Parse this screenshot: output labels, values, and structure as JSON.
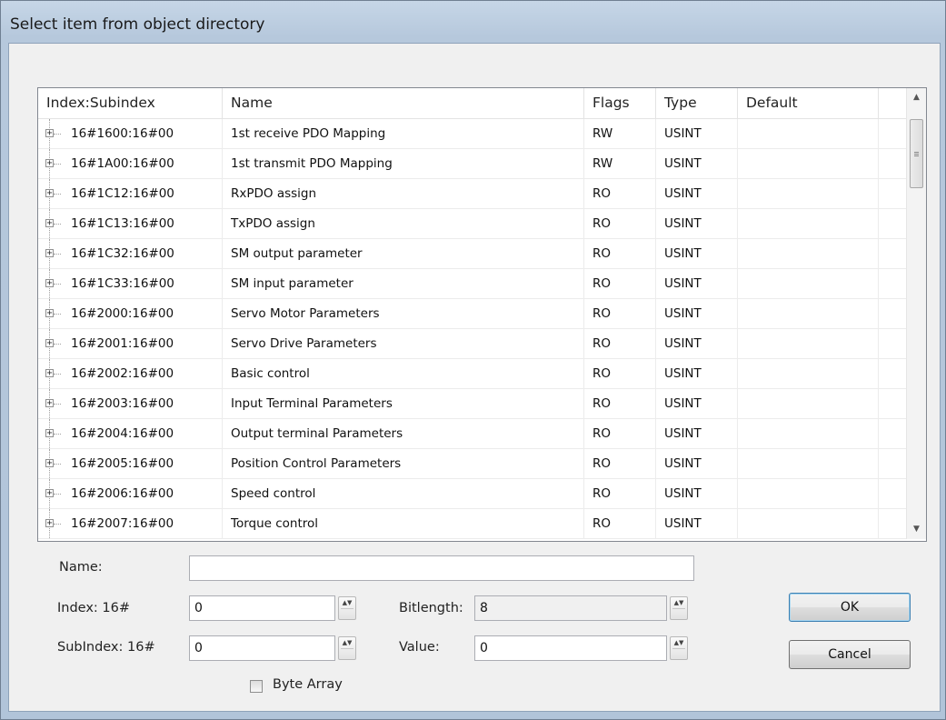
{
  "window": {
    "title": "Select item from object directory"
  },
  "table": {
    "columns": [
      "Index:Subindex",
      "Name",
      "Flags",
      "Type",
      "Default"
    ],
    "rows": [
      {
        "index": "16#1600:16#00",
        "name": "1st receive PDO Mapping",
        "flags": "RW",
        "type": "USINT",
        "default": ""
      },
      {
        "index": "16#1A00:16#00",
        "name": "1st transmit PDO Mapping",
        "flags": "RW",
        "type": "USINT",
        "default": ""
      },
      {
        "index": "16#1C12:16#00",
        "name": "RxPDO assign",
        "flags": "RO",
        "type": "USINT",
        "default": ""
      },
      {
        "index": "16#1C13:16#00",
        "name": "TxPDO assign",
        "flags": "RO",
        "type": "USINT",
        "default": ""
      },
      {
        "index": "16#1C32:16#00",
        "name": "SM output parameter",
        "flags": "RO",
        "type": "USINT",
        "default": ""
      },
      {
        "index": "16#1C33:16#00",
        "name": "SM input parameter",
        "flags": "RO",
        "type": "USINT",
        "default": ""
      },
      {
        "index": "16#2000:16#00",
        "name": "Servo Motor Parameters",
        "flags": "RO",
        "type": "USINT",
        "default": ""
      },
      {
        "index": "16#2001:16#00",
        "name": "Servo Drive Parameters",
        "flags": "RO",
        "type": "USINT",
        "default": ""
      },
      {
        "index": "16#2002:16#00",
        "name": "Basic control",
        "flags": "RO",
        "type": "USINT",
        "default": ""
      },
      {
        "index": "16#2003:16#00",
        "name": "Input Terminal Parameters",
        "flags": "RO",
        "type": "USINT",
        "default": ""
      },
      {
        "index": "16#2004:16#00",
        "name": "Output terminal Parameters",
        "flags": "RO",
        "type": "USINT",
        "default": ""
      },
      {
        "index": "16#2005:16#00",
        "name": "Position Control Parameters",
        "flags": "RO",
        "type": "USINT",
        "default": ""
      },
      {
        "index": "16#2006:16#00",
        "name": "Speed control",
        "flags": "RO",
        "type": "USINT",
        "default": ""
      },
      {
        "index": "16#2007:16#00",
        "name": "Torque control",
        "flags": "RO",
        "type": "USINT",
        "default": ""
      }
    ]
  },
  "form": {
    "name_label": "Name:",
    "name_value": "",
    "index_label": "Index: 16#",
    "index_value": "0",
    "subindex_label": "SubIndex: 16#",
    "subindex_value": "0",
    "bitlength_label": "Bitlength:",
    "bitlength_value": "8",
    "value_label": "Value:",
    "value_value": "0",
    "byte_array_label": "Byte Array",
    "byte_array_checked": false
  },
  "buttons": {
    "ok": "OK",
    "cancel": "Cancel"
  },
  "icons": {
    "expand": "plus-box-icon",
    "scroll_up": "arrow-up-icon",
    "scroll_down": "arrow-down-icon",
    "spin": "spin-updown-icon"
  }
}
